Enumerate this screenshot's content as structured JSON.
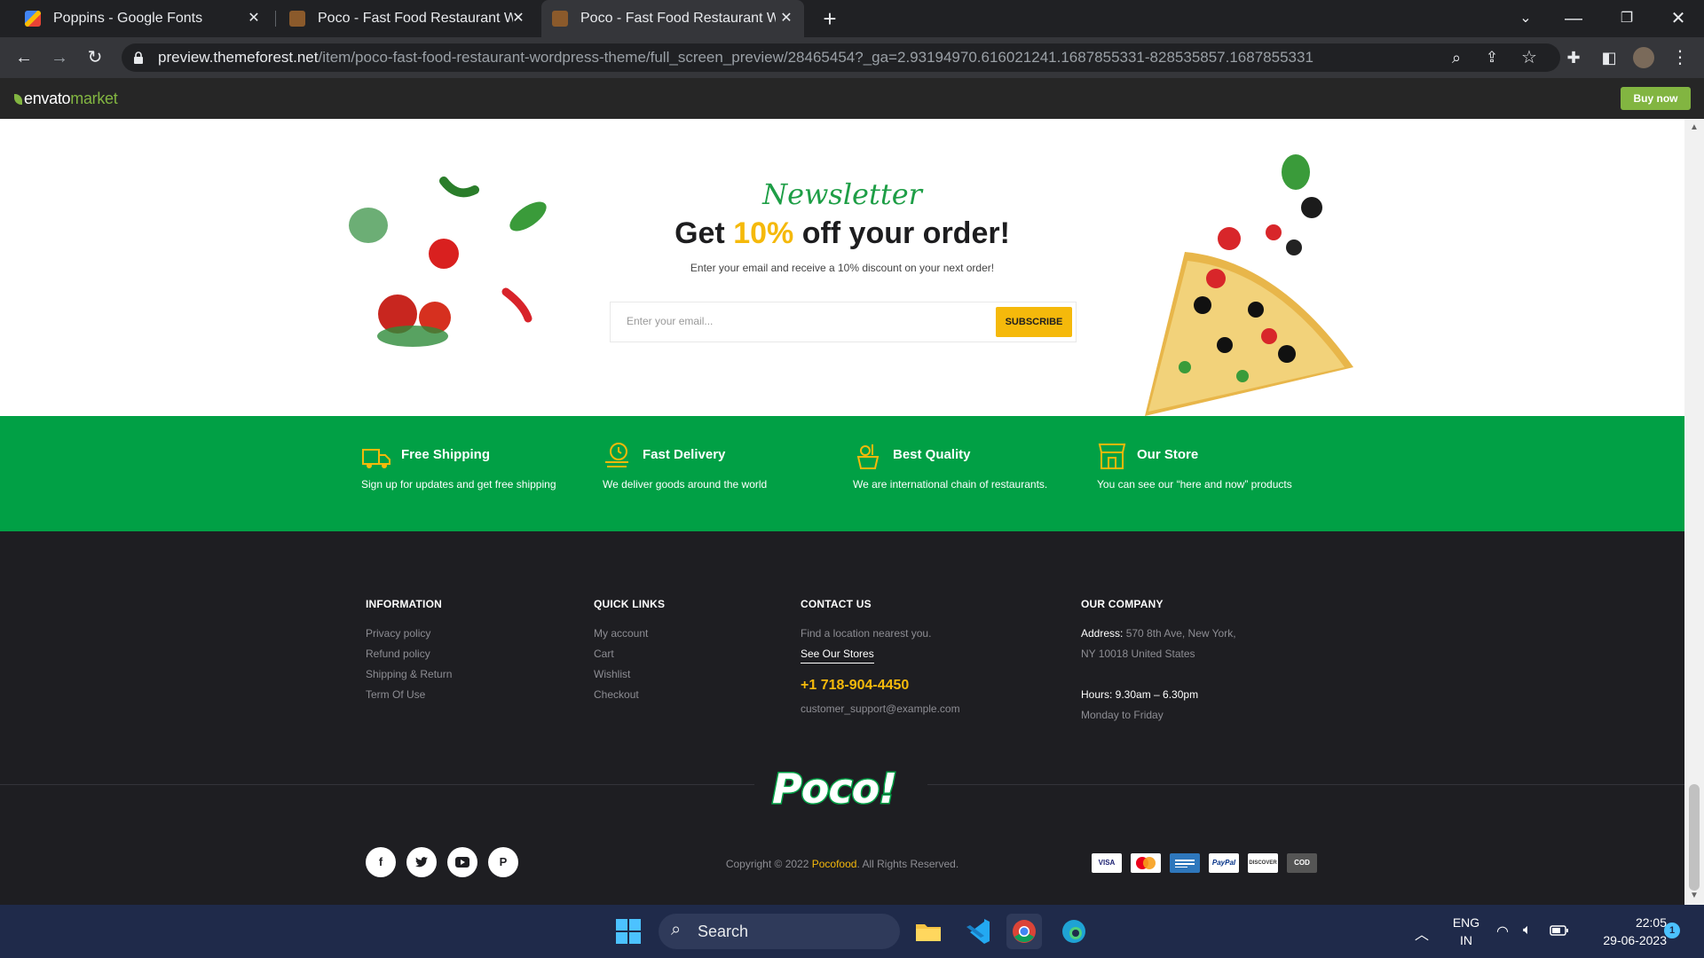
{
  "browser": {
    "tabs": [
      {
        "title": "Poppins - Google Fonts",
        "active": false
      },
      {
        "title": "Poco - Fast Food Restaurant Wor",
        "active": false
      },
      {
        "title": "Poco - Fast Food Restaurant Wor",
        "active": true
      }
    ],
    "url_domain": "preview.themeforest.net",
    "url_path": "/item/poco-fast-food-restaurant-wordpress-theme/full_screen_preview/28465454?_ga=2.93194970.616021241.1687855331-828535857.1687855331"
  },
  "envato": {
    "logo_a": "envato",
    "logo_b": "market",
    "buy_label": "Buy now"
  },
  "newsletter": {
    "script": "Newsletter",
    "title_a": "Get ",
    "title_hl": "10%",
    "title_b": " off your order!",
    "subtitle": "Enter your email and receive a 10% discount on your next order!",
    "placeholder": "Enter your email...",
    "button": "SUBSCRIBE"
  },
  "features": [
    {
      "title": "Free Shipping",
      "desc": "Sign up for updates and get free shipping"
    },
    {
      "title": "Fast Delivery",
      "desc": "We deliver goods around the world"
    },
    {
      "title": "Best Quality",
      "desc": "We are international chain of restaurants."
    },
    {
      "title": "Our Store",
      "desc": "You can see our “here and now” products"
    }
  ],
  "footer": {
    "info_title": "INFORMATION",
    "info_links": [
      "Privacy policy",
      "Refund policy",
      "Shipping & Return",
      "Term Of Use"
    ],
    "quick_title": "QUICK LINKS",
    "quick_links": [
      "My account",
      "Cart",
      "Wishlist",
      "Checkout"
    ],
    "contact_title": "CONTACT US",
    "contact_text": "Find a location nearest you.",
    "see_stores": "See Our Stores",
    "phone": "+1 718-904-4450",
    "email": "customer_support@example.com",
    "company_title": "OUR COMPANY",
    "address_label": "Address:",
    "address_1": " 570 8th Ave, New York,",
    "address_2": "NY 10018 United States",
    "hours_label": "Hours:",
    "hours_value": " 9.30am – 6.30pm",
    "days": "Monday to Friday",
    "brand_logo": "Poco!",
    "copyright_a": "Copyright © 2022 ",
    "copyright_brand": "Pocofood",
    "copyright_b": ". All Rights Reserved.",
    "payments": [
      "VISA",
      "MC",
      "AMEX",
      "PayPal",
      "DISCOVER",
      "COD"
    ]
  },
  "taskbar": {
    "search": "Search",
    "lang_1": "ENG",
    "lang_2": "IN",
    "time": "22:05",
    "date": "29-06-2023",
    "notif_count": "1"
  },
  "colors": {
    "green": "#01a045",
    "yellow": "#f5b90b",
    "dark": "#1e1e22"
  }
}
